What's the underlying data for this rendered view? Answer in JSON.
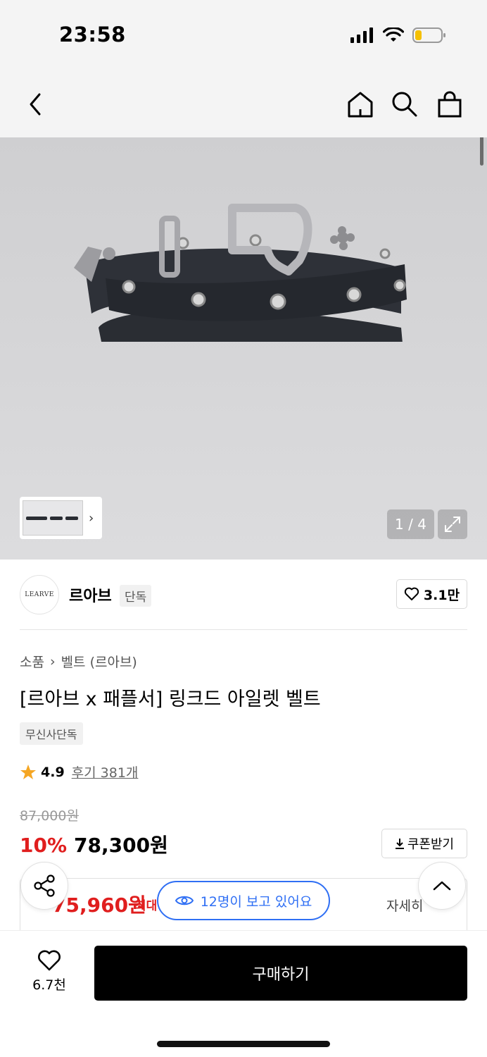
{
  "status": {
    "time": "23:58"
  },
  "nav": {
    "back_icon": "back-arrow-icon",
    "home_icon": "home-icon",
    "search_icon": "search-icon",
    "cart_icon": "shopping-bag-icon"
  },
  "gallery": {
    "counter": "1 / 4",
    "current_page": 1,
    "total_pages": 4
  },
  "brand": {
    "logo_text": "LEARVE",
    "name": "르아브",
    "tag": "단독",
    "likes": "3.1만"
  },
  "breadcrumb": {
    "category": "소품",
    "subcategory": "벨트 (르아브)"
  },
  "product": {
    "title": "[르아브 x 패플서] 링크드 아일렛 벨트",
    "badge": "무신사단독",
    "rating": "4.9",
    "reviews": "후기 381개",
    "original_price": "87,000원",
    "discount": "10%",
    "price": "78,300원",
    "coupon_label": "쿠폰받기"
  },
  "max_benefit": {
    "price": "75,960원",
    "label": "최대",
    "detail": "자세히"
  },
  "viewers": {
    "text": "12명이 보고 있어요"
  },
  "bottom": {
    "wish_count": "6.7천",
    "buy_label": "구매하기"
  },
  "colors": {
    "accent_red": "#e01e1e",
    "accent_blue": "#2f6ff4",
    "star": "#f5a623"
  }
}
